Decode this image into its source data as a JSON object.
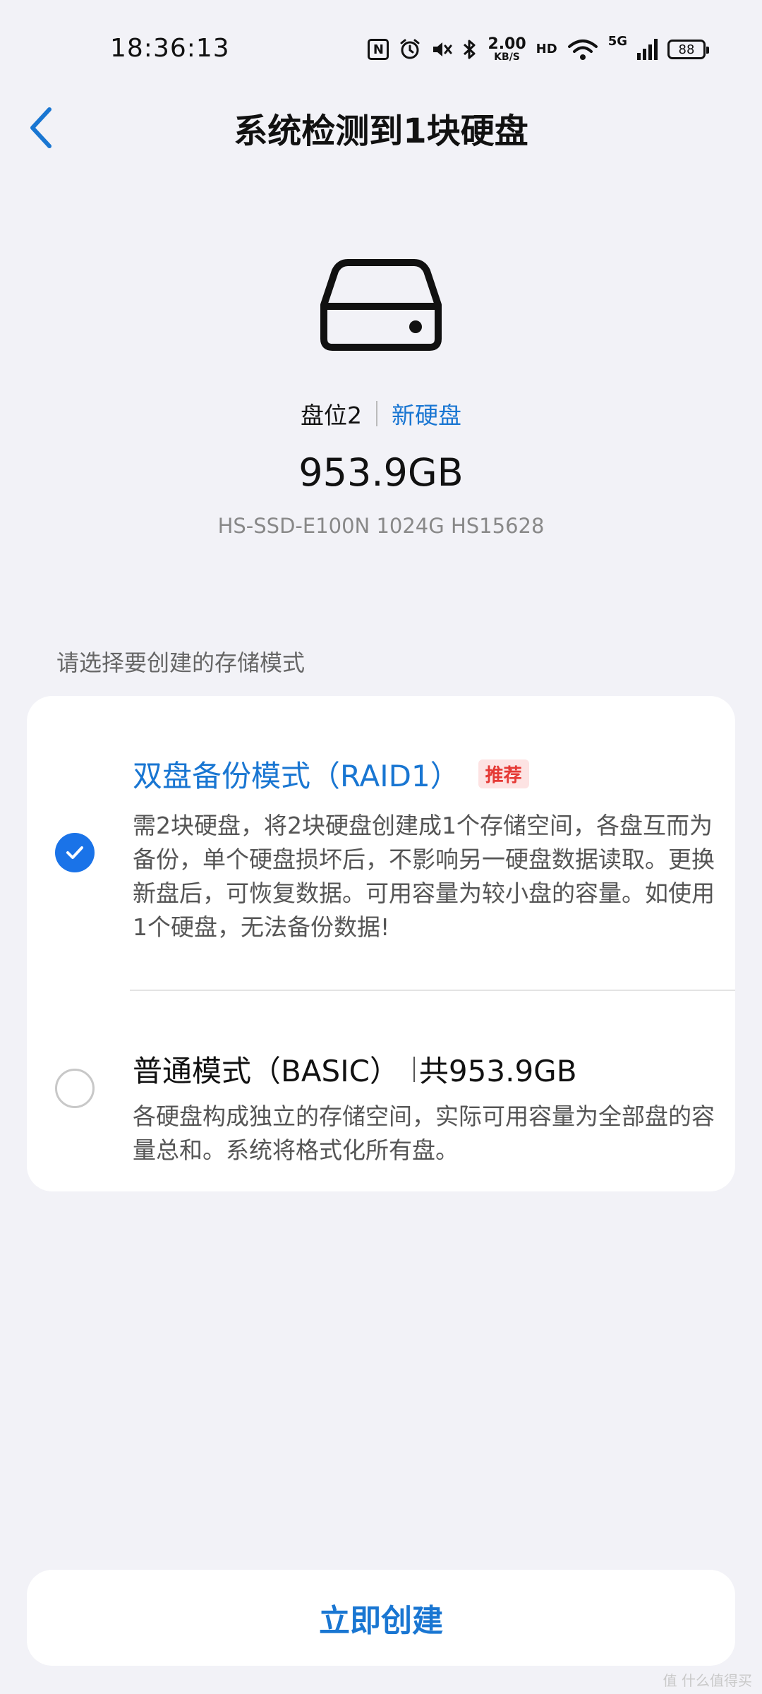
{
  "status_bar": {
    "time": "18:36:13",
    "net_speed_value": "2.00",
    "net_speed_unit": "KB/S",
    "hd_label": "HD",
    "network_type": "5G",
    "battery": "88",
    "icons": [
      "nfc-icon",
      "alarm-icon",
      "mute-icon",
      "bluetooth-icon",
      "wifi-icon",
      "signal-icon",
      "battery-icon"
    ]
  },
  "header": {
    "title": "系统检测到1块硬盘"
  },
  "disk": {
    "slot": "盘位2",
    "status": "新硬盘",
    "capacity": "953.9GB",
    "model": "HS-SSD-E100N 1024G HS15628"
  },
  "section_label": "请选择要创建的存储模式",
  "modes": [
    {
      "title": "双盘备份模式（RAID1）",
      "badge": "推荐",
      "description": "需2块硬盘，将2块硬盘创建成1个存储空间，各盘互而为备份，单个硬盘损坏后，不影响另一硬盘数据读取。更换新盘后，可恢复数据。可用容量为较小盘的容量。如使用1个硬盘，无法备份数据!",
      "selected": true
    },
    {
      "title": "普通模式（BASIC）",
      "capacity_note": "共953.9GB",
      "description": "各硬盘构成独立的存储空间，实际可用容量为全部盘的容量总和。系统将格式化所有盘。",
      "selected": false
    }
  ],
  "create_button": "立即创建",
  "watermark": "值 什么值得买",
  "colors": {
    "accent": "#1976d2",
    "badge_bg": "#fde3e3",
    "badge_text": "#e53935",
    "background": "#f2f2f7"
  }
}
